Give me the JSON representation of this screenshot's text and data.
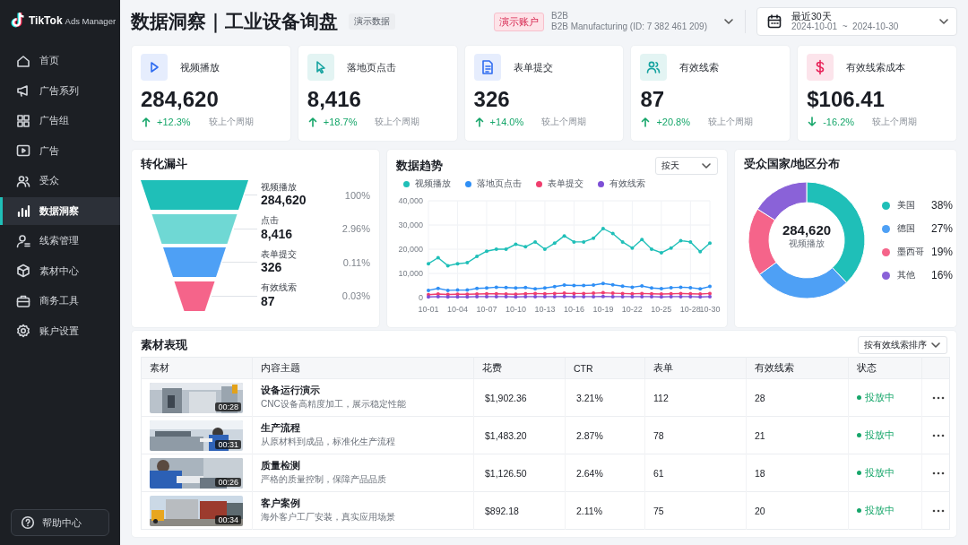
{
  "brand": {
    "name": "TikTok",
    "product": "Ads Manager"
  },
  "sidebar": {
    "items": [
      {
        "label": "首页",
        "selected": false
      },
      {
        "label": "广告系列",
        "selected": false
      },
      {
        "label": "广告组",
        "selected": false
      },
      {
        "label": "广告",
        "selected": false
      },
      {
        "label": "受众",
        "selected": false
      },
      {
        "label": "数据洞察",
        "selected": true
      },
      {
        "label": "线索管理",
        "selected": false
      },
      {
        "label": "素材中心",
        "selected": false
      },
      {
        "label": "商务工具",
        "selected": false
      },
      {
        "label": "账户设置",
        "selected": false
      }
    ],
    "help": "帮助中心"
  },
  "header": {
    "title": "数据洞察｜工业设备询盘",
    "badge": "演示数据",
    "account_badge": "演示账户",
    "account_type": "B2B",
    "account_name": "B2B Manufacturing (ID: 7 382 461 209)",
    "date_label": "最近30天",
    "date_range": "2024-10-01  ~  2024-10-30"
  },
  "kpis": [
    {
      "label": "视频播放",
      "value": "284,620",
      "change": "+12.3%",
      "up": true,
      "compare": "较上个周期",
      "color": "#2f6cf0"
    },
    {
      "label": "落地页点击",
      "value": "8,416",
      "change": "+18.7%",
      "up": true,
      "compare": "较上个周期",
      "color": "#16a3a0"
    },
    {
      "label": "表单提交",
      "value": "326",
      "change": "+14.0%",
      "up": true,
      "compare": "较上个周期",
      "color": "#2f6cf0"
    },
    {
      "label": "有效线索",
      "value": "87",
      "change": "+20.8%",
      "up": true,
      "compare": "较上个周期",
      "color": "#16a3a0"
    },
    {
      "label": "有效线索成本",
      "value": "$106.41",
      "change": "-16.2%",
      "up": false,
      "compare": "较上个周期",
      "color": "#e8245a"
    }
  ],
  "funnel": {
    "title": "转化漏斗",
    "stages": [
      {
        "label": "视频播放",
        "value": "284,620",
        "rate": "100%",
        "color": "#1fbfb8"
      },
      {
        "label": "点击",
        "value": "8,416",
        "rate": "2.96%",
        "color": "#6fd8d4"
      },
      {
        "label": "表单提交",
        "value": "326",
        "rate": "0.11%",
        "color": "#4ea0f5"
      },
      {
        "label": "有效线索",
        "value": "87",
        "rate": "0.03%",
        "color": "#f5648a"
      }
    ]
  },
  "trend": {
    "title": "数据趋势",
    "granularity": "按天",
    "chart_data": {
      "type": "line",
      "categories": [
        "10-01",
        null,
        null,
        "10-04",
        null,
        null,
        "10-07",
        null,
        null,
        "10-10",
        null,
        null,
        "10-13",
        null,
        null,
        "10-16",
        null,
        null,
        "10-19",
        null,
        null,
        "10-22",
        null,
        null,
        "10-25",
        null,
        null,
        "10-28",
        null,
        "10-30"
      ],
      "ylim": [
        0,
        40000
      ],
      "grid": true,
      "yticks": [
        {
          "value": 0,
          "label": "0"
        },
        {
          "value": 10000,
          "label": "10,000"
        },
        {
          "value": 20000,
          "label": "20,000"
        },
        {
          "value": 30000,
          "label": "30,000"
        },
        {
          "value": 40000,
          "label": "40,000"
        }
      ],
      "series": [
        {
          "name": "视频播放",
          "color": "#1fbfb8",
          "values": [
            14000,
            16500,
            13200,
            14000,
            14400,
            17000,
            19200,
            20000,
            20000,
            22000,
            21000,
            23000,
            20000,
            22500,
            25500,
            23000,
            23000,
            24500,
            28500,
            26500,
            23000,
            20500,
            24000,
            20000,
            18500,
            20500,
            23500,
            23000,
            19000,
            22500
          ]
        },
        {
          "name": "落地页点击",
          "color": "#2f8ff5",
          "values": [
            3000,
            3800,
            3000,
            3100,
            3100,
            3800,
            4000,
            4300,
            4200,
            4000,
            4200,
            3600,
            4000,
            4500,
            5200,
            5000,
            5000,
            5200,
            5800,
            5300,
            4700,
            4300,
            4800,
            4000,
            3700,
            4100,
            4300,
            4100,
            3600,
            4600
          ]
        },
        {
          "name": "表单提交",
          "color": "#f03e6e",
          "values": [
            1200,
            1500,
            1300,
            1400,
            1400,
            1500,
            1600,
            1600,
            1500,
            1400,
            1600,
            1700,
            1600,
            1700,
            1800,
            1700,
            1700,
            1800,
            2000,
            1800,
            1700,
            1600,
            1700,
            1600,
            1500,
            1600,
            1700,
            1600,
            1500,
            1700
          ]
        },
        {
          "name": "有效线索",
          "color": "#7d4fd6",
          "values": [
            300,
            400,
            300,
            300,
            300,
            400,
            400,
            400,
            400,
            300,
            400,
            400,
            400,
            400,
            500,
            400,
            400,
            400,
            500,
            400,
            400,
            400,
            400,
            400,
            300,
            400,
            400,
            400,
            300,
            400
          ]
        }
      ]
    }
  },
  "audience": {
    "title": "受众国家/地区分布",
    "center_value": "284,620",
    "center_label": "视频播放",
    "chart_data": {
      "type": "donut",
      "categories": [
        "美国",
        "德国",
        "墨西哥",
        "其他"
      ],
      "values": [
        38,
        27,
        19,
        16
      ],
      "value_labels": [
        "38%",
        "27%",
        "19%",
        "16%"
      ],
      "colors": [
        "#1fbfb8",
        "#4ea0f5",
        "#f5648a",
        "#8a62d8"
      ]
    }
  },
  "assets": {
    "title": "素材表现",
    "sort": "按有效线索排序",
    "columns": [
      "素材",
      "内容主题",
      "花费",
      "CTR",
      "表单",
      "有效线索",
      "状态"
    ],
    "rows": [
      {
        "duration": "00:28",
        "title": "设备运行演示",
        "subtitle": "CNC设备高精度加工，展示稳定性能",
        "spend": "$1,902.36",
        "ctr": "3.21%",
        "forms": "112",
        "leads": "28",
        "status": "投放中",
        "kind": "machine"
      },
      {
        "duration": "00:31",
        "title": "生产流程",
        "subtitle": "从原材料到成品，标准化生产流程",
        "spend": "$1,483.20",
        "ctr": "2.87%",
        "forms": "78",
        "leads": "21",
        "status": "投放中",
        "kind": "factory"
      },
      {
        "duration": "00:26",
        "title": "质量检测",
        "subtitle": "严格的质量控制，保障产品品质",
        "spend": "$1,126.50",
        "ctr": "2.64%",
        "forms": "61",
        "leads": "18",
        "status": "投放中",
        "kind": "worker"
      },
      {
        "duration": "00:34",
        "title": "客户案例",
        "subtitle": "海外客户工厂安装，真实应用场景",
        "spend": "$892.18",
        "ctr": "2.11%",
        "forms": "75",
        "leads": "20",
        "status": "投放中",
        "kind": "yard"
      }
    ]
  }
}
